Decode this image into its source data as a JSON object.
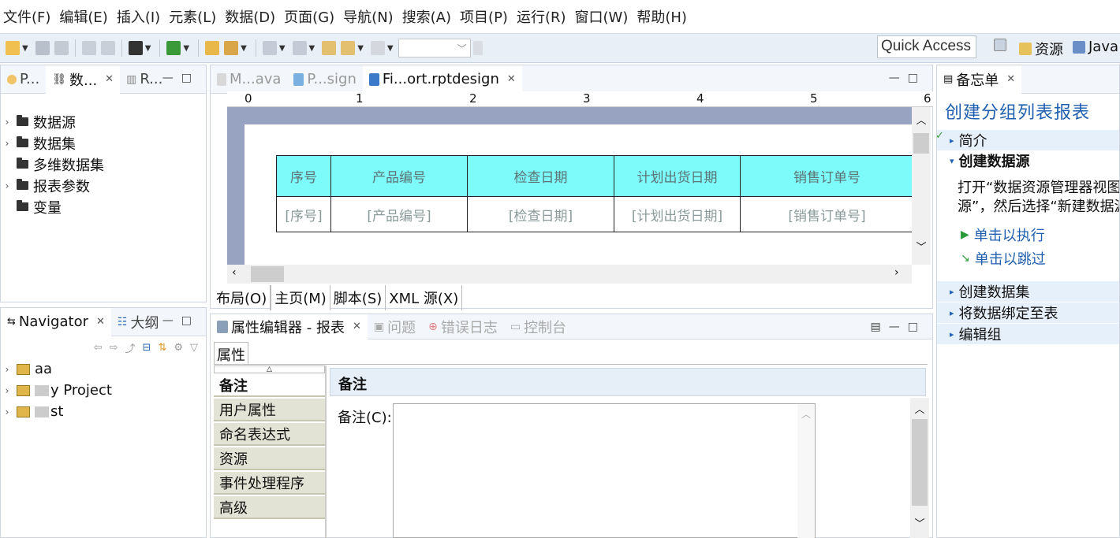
{
  "menubar": [
    "文件(F)",
    "编辑(E)",
    "插入(I)",
    "元素(L)",
    "数据(D)",
    "页面(G)",
    "导航(N)",
    "搜索(A)",
    "项目(P)",
    "运行(R)",
    "窗口(W)",
    "帮助(H)"
  ],
  "toolbar": {
    "quick_access": "Quick Access",
    "perspective_resource": "资源",
    "perspective_java": "Java"
  },
  "left_top": {
    "tabs": [
      "P...",
      "数...",
      "R..."
    ],
    "tree": [
      "数据源",
      "数据集",
      "多维数据集",
      "报表参数",
      "变量"
    ]
  },
  "left_bottom": {
    "tabs": [
      "Navigator",
      "大纲"
    ],
    "projects": [
      "aa",
      "y Project",
      "st"
    ]
  },
  "editor": {
    "tabs": [
      "M...ava",
      "P...sign",
      "Fi...ort.rptdesign"
    ],
    "ruler_marks": [
      "0",
      "1",
      "2",
      "3",
      "4",
      "5",
      "6"
    ],
    "table_headers": [
      "序号",
      "产品编号",
      "检查日期",
      "计划出货日期",
      "销售订单号"
    ],
    "table_row": [
      "[序号]",
      "[产品编号]",
      "[检查日期]",
      "[计划出货日期]",
      "[销售订单号]"
    ],
    "bottom_tabs": [
      "布局(O)",
      "主页(M)",
      "脚本(S)",
      "XML 源(X)"
    ]
  },
  "properties": {
    "tabs": [
      "属性编辑器 - 报表",
      "问题",
      "错误日志",
      "控制台"
    ],
    "sub_tab": "属性",
    "categories": [
      "备注",
      "用户属性",
      "命名表达式",
      "资源",
      "事件处理程序",
      "高级"
    ],
    "section_title": "备注",
    "field_label": "备注(C):"
  },
  "cheatsheet": {
    "tab": "备忘单",
    "title": "创建分组列表报表",
    "steps": [
      "简介",
      "创建数据源"
    ],
    "description": "打开“数据资源管理器视图”，然后右键单击“数据源”，然后选择“新建数据源”。",
    "description_line1": "打开“数据资源管理器视图”",
    "description_line2": "源”，然后选择“新建数据源",
    "actions": [
      "单击以执行",
      "单击以跳过"
    ],
    "more_steps": [
      "创建数据集",
      "将数据绑定至表",
      "编辑组"
    ]
  },
  "colors": {
    "accent": "#1f5fb0",
    "table_header": "#7dfafa",
    "canvas_bg": "#98a3c2",
    "toolbar_bg": "#e9eff7"
  }
}
